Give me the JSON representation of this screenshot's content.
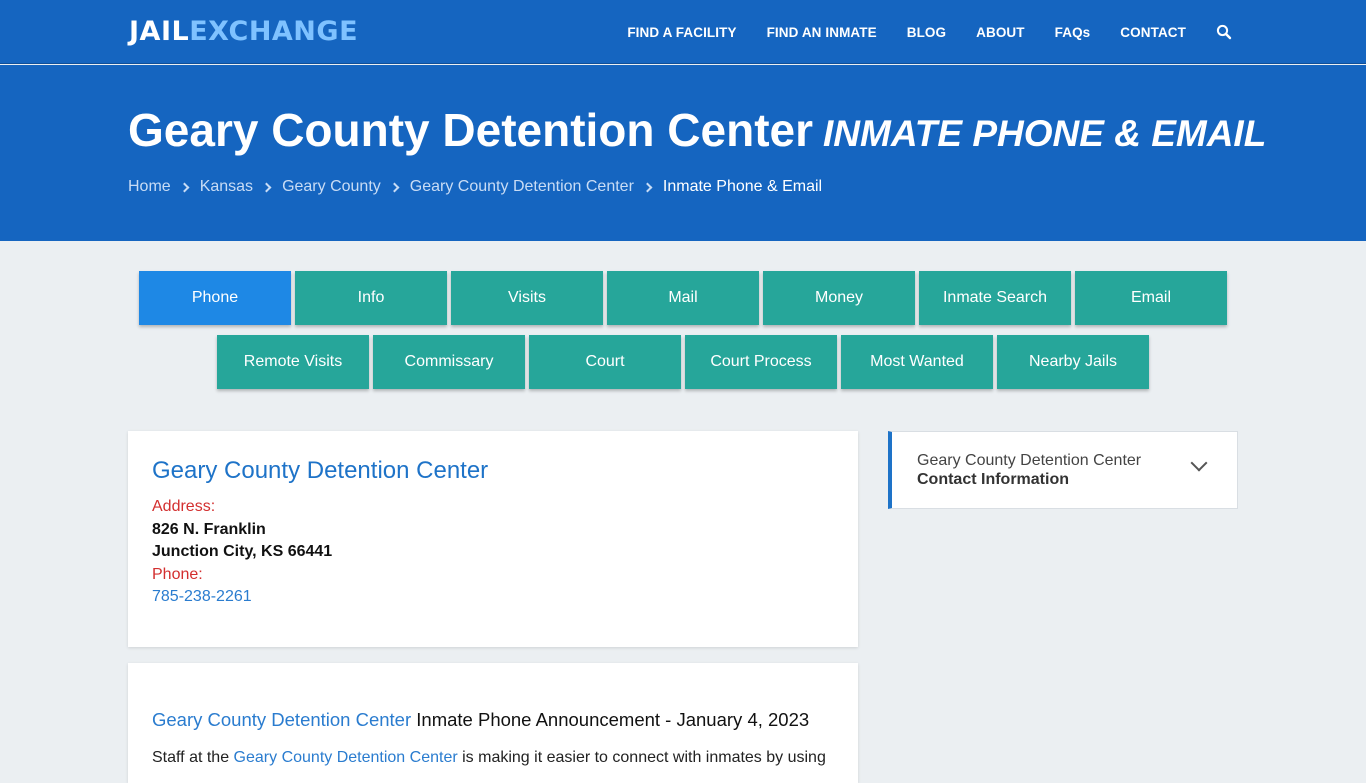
{
  "header": {
    "logo_part1": "JAIL",
    "logo_part2": "EXCHANGE",
    "nav": [
      "FIND A FACILITY",
      "FIND AN INMATE",
      "BLOG",
      "ABOUT",
      "FAQs",
      "CONTACT"
    ],
    "search_icon": "search-icon"
  },
  "hero": {
    "title": "Geary County Detention Center",
    "subtitle": "INMATE PHONE & EMAIL",
    "breadcrumbs": [
      "Home",
      "Kansas",
      "Geary County",
      "Geary County Detention Center"
    ],
    "breadcrumb_current": "Inmate Phone & Email"
  },
  "tabs": {
    "row1": [
      "Phone",
      "Info",
      "Visits",
      "Mail",
      "Money",
      "Inmate Search",
      "Email"
    ],
    "row2": [
      "Remote Visits",
      "Commissary",
      "Court",
      "Court Process",
      "Most Wanted",
      "Nearby Jails"
    ],
    "active": "Phone"
  },
  "facility": {
    "name": "Geary County Detention Center",
    "address_label": "Address:",
    "address_line1": "826 N. Franklin",
    "address_line2": "Junction City, KS 66441",
    "phone_label": "Phone:",
    "phone": "785-238-2261"
  },
  "announcement": {
    "facility_link": "Geary County Detention Center",
    "heading_rest": " Inmate Phone Announcement - January 4, 2023",
    "body_start": "Staff at the ",
    "body_link": "Geary County Detention Center",
    "body_end": " is making it easier to connect with inmates by using"
  },
  "sidebar": {
    "line1": "Geary County Detention Center",
    "line2": "Contact Information"
  },
  "colors": {
    "header_blue": "#1565c0",
    "tab_teal": "#26a69a",
    "tab_active": "#1e88e5",
    "link_blue": "#2a7ccf",
    "label_red": "#d32f2f"
  }
}
